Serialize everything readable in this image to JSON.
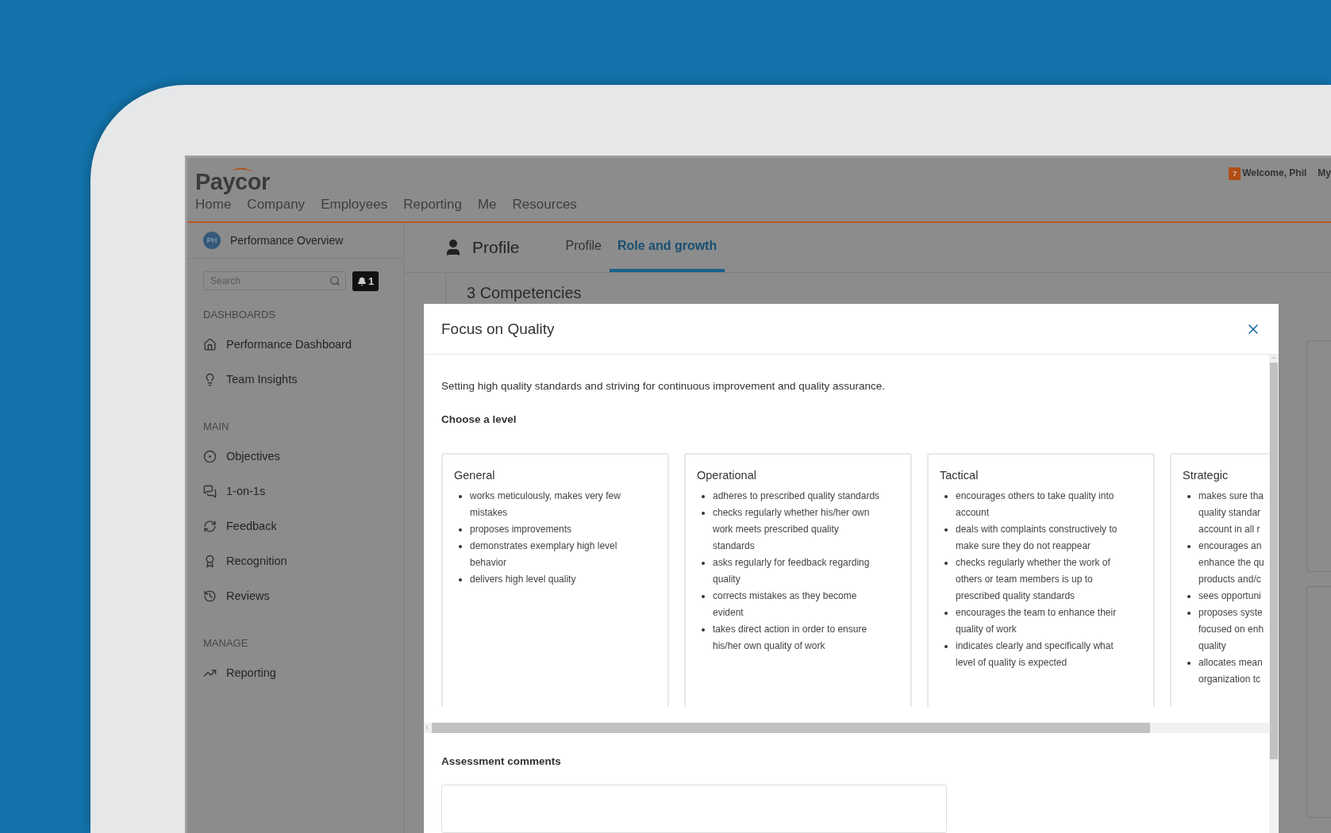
{
  "header": {
    "logo": "Paycor",
    "nav": [
      {
        "label": "Home"
      },
      {
        "label": "Company"
      },
      {
        "label": "Employees"
      },
      {
        "label": "Reporting"
      },
      {
        "label": "Me"
      },
      {
        "label": "Resources"
      }
    ],
    "notification_count": "7",
    "welcome": "Welcome, Phil",
    "menu_cut": "My"
  },
  "sidebar": {
    "avatar": "PH",
    "title": "Performance Overview",
    "search": {
      "placeholder": "Search"
    },
    "alerts": "1",
    "sections": [
      {
        "heading": "DASHBOARDS",
        "items": [
          {
            "label": "Performance Dashboard"
          },
          {
            "label": "Team Insights"
          }
        ]
      },
      {
        "heading": "MAIN",
        "items": [
          {
            "label": "Objectives"
          },
          {
            "label": "1-on-1s"
          },
          {
            "label": "Feedback"
          },
          {
            "label": "Recognition"
          },
          {
            "label": "Reviews"
          }
        ]
      },
      {
        "heading": "MANAGE",
        "items": [
          {
            "label": "Reporting"
          }
        ]
      }
    ]
  },
  "page": {
    "title": "Profile",
    "tabs": [
      {
        "label": "Profile",
        "selected": false
      },
      {
        "label": "Role and growth",
        "selected": true
      }
    ],
    "section_title": "3 Competencies"
  },
  "modal": {
    "title": "Focus on Quality",
    "description": "Setting high quality standards and striving for continuous improvement and quality assurance.",
    "choose_label": "Choose a level",
    "levels": [
      {
        "title": "General",
        "bullets": [
          [
            "works meticulously, makes very few",
            "mistakes"
          ],
          [
            "proposes improvements"
          ],
          [
            "demonstrates exemplary high level",
            "behavior"
          ],
          [
            "delivers high level quality"
          ]
        ]
      },
      {
        "title": "Operational",
        "bullets": [
          [
            "adheres to prescribed quality standards"
          ],
          [
            "checks regularly whether his/her own",
            "work meets prescribed quality",
            "standards"
          ],
          [
            "asks regularly for feedback regarding",
            "quality"
          ],
          [
            "corrects mistakes as they become",
            "evident"
          ],
          [
            "takes direct action in order to ensure",
            "his/her own quality of work"
          ]
        ]
      },
      {
        "title": "Tactical",
        "bullets": [
          [
            "encourages others to take quality into",
            "account"
          ],
          [
            "deals with complaints constructively to",
            "make sure they do not reappear"
          ],
          [
            "checks regularly whether the work of",
            "others or team members is up to",
            "prescribed quality standards"
          ],
          [
            "encourages the team to enhance their",
            "quality of work"
          ],
          [
            "indicates clearly and specifically what",
            "level of quality is expected"
          ]
        ]
      },
      {
        "title": "Strategic",
        "bullets": [
          [
            "makes sure tha",
            "quality standar",
            "account in all r"
          ],
          [
            "encourages an",
            "enhance the qu",
            "products and/c"
          ],
          [
            "sees opportuni"
          ],
          [
            "proposes syste",
            "focused on enh",
            "quality"
          ],
          [
            "allocates mean",
            "organization tc"
          ]
        ]
      }
    ],
    "comments_label": "Assessment comments"
  }
}
